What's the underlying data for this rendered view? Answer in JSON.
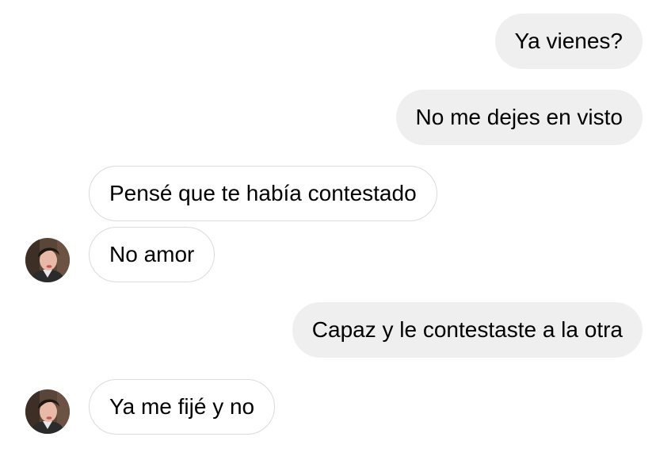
{
  "conversation": {
    "messages": [
      {
        "direction": "outgoing",
        "text": "Ya vienes?"
      },
      {
        "direction": "outgoing",
        "text": "No me dejes en visto"
      },
      {
        "direction": "incoming",
        "text": "Pensé que te había contestado"
      },
      {
        "direction": "incoming",
        "text": "No amor"
      },
      {
        "direction": "outgoing",
        "text": "Capaz y le contestaste a la otra"
      },
      {
        "direction": "incoming",
        "text": "Ya me fijé y no"
      }
    ]
  },
  "colors": {
    "outgoing_bubble": "#efefef",
    "incoming_border": "#dbdbdb",
    "text": "#000000"
  },
  "icons": {
    "avatar": "profile-photo"
  }
}
